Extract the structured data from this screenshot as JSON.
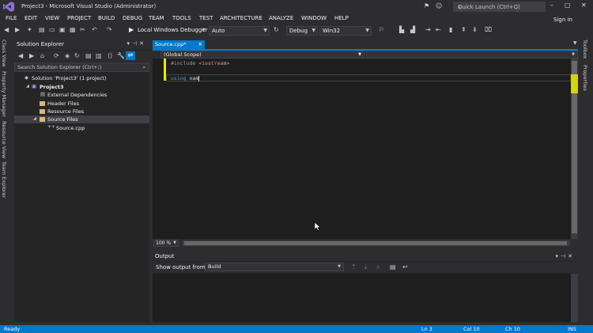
{
  "window": {
    "title": "Project3 - Microsoft Visual Studio (Administrator)",
    "quick_launch_placeholder": "Quick Launch (Ctrl+Q)",
    "sign_in": "Sign in"
  },
  "menu": [
    "FILE",
    "EDIT",
    "VIEW",
    "PROJECT",
    "BUILD",
    "DEBUG",
    "TEAM",
    "TOOLS",
    "TEST",
    "ARCHITECTURE",
    "ANALYZE",
    "WINDOW",
    "HELP"
  ],
  "toolbar": {
    "debugger_label": "Local Windows Debugger",
    "solution_config": "Auto",
    "build_config": "Debug",
    "platform": "Win32"
  },
  "left_tabs": [
    "Class View",
    "Property Manager",
    "Resource View",
    "Team Explorer"
  ],
  "right_tabs": [
    "Toolbox",
    "Properties"
  ],
  "solution_explorer": {
    "title": "Solution Explorer",
    "search_placeholder": "Search Solution Explorer (Ctrl+;)",
    "tree": [
      {
        "label": "Solution 'Project3' (1 project)",
        "icon": "solution-icon",
        "depth": 0
      },
      {
        "label": "Project3",
        "icon": "project-icon",
        "depth": 1
      },
      {
        "label": "External Dependencies",
        "icon": "dependencies-icon",
        "depth": 2
      },
      {
        "label": "Header Files",
        "icon": "folder-icon",
        "depth": 2
      },
      {
        "label": "Resource Files",
        "icon": "folder-icon",
        "depth": 2
      },
      {
        "label": "Source Files",
        "icon": "folder-icon",
        "depth": 2,
        "selected": true
      },
      {
        "label": "Source.cpp",
        "icon": "cpp-file-icon",
        "depth": 3
      }
    ]
  },
  "editor": {
    "tab_label": "Source.cpp*",
    "scope": "(Global Scope)",
    "lines": [
      {
        "directive": "#include",
        "rest": " <iostream>"
      },
      {
        "keyword": "using",
        "rest": " nam"
      }
    ],
    "zoom": "100 %"
  },
  "output": {
    "title": "Output",
    "show_from_label": "Show output from:",
    "source": "Build"
  },
  "status": {
    "state": "Ready",
    "line": "Ln 3",
    "col": "Col 10",
    "ch": "Ch 10",
    "mode": "INS"
  },
  "colors": {
    "accent": "#007acc",
    "editor_bg": "#1e1e1e",
    "chrome_bg": "#2d2d30",
    "keyword": "#569cd6",
    "directive": "#9b9b9b",
    "changed_margin": "#eaea00"
  }
}
